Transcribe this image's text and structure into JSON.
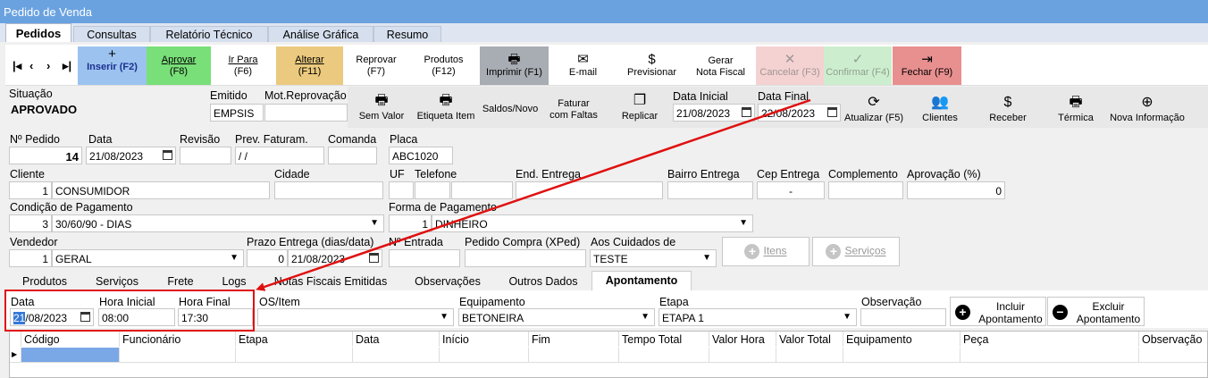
{
  "window": {
    "title": "Pedido de Venda"
  },
  "main_tabs": [
    {
      "label": "Pedidos"
    },
    {
      "label": "Consultas"
    },
    {
      "label": "Relatório Técnico"
    },
    {
      "label": "Análise Gráfica"
    },
    {
      "label": "Resumo"
    }
  ],
  "nav": {
    "first": "⏮",
    "prev": "‹",
    "next": "›",
    "last": "⏭"
  },
  "toolbar": {
    "inserir": "Inserir (F2)",
    "aprovar": "Aprovar",
    "aprovar_key": "(F8)",
    "irpara": "Ir Para",
    "irpara_key": "(F6)",
    "alterar": "Alterar",
    "alterar_key": "(F11)",
    "reprovar": "Reprovar",
    "reprovar_key": "(F7)",
    "produtos": "Produtos",
    "produtos_key": "(F12)",
    "imprimir": "Imprimir (F1)",
    "email": "E-mail",
    "previsionar": "Previsionar",
    "gerar": "Gerar",
    "gerar2": "Nota Fiscal",
    "cancelar": "Cancelar (F3)",
    "confirmar": "Confirmar (F4)",
    "fechar": "Fechar (F9)"
  },
  "status": {
    "situacao_label": "Situação",
    "situacao": "APROVADO",
    "emitido_label": "Emitido",
    "emitido": "EMPSIS",
    "motrep_label": "Mot.Reprovação",
    "motrep": ""
  },
  "actions": {
    "semvalor": "Sem Valor",
    "etiqueta": "Etiqueta Item",
    "saldos": "Saldos/Novo",
    "faturar": "Faturar",
    "faturar2": "com Faltas",
    "replicar": "Replicar",
    "data_inicial_label": "Data Inicial",
    "data_inicial": "21/08/2023",
    "data_final_label": "Data Final",
    "data_final": "22/08/2023",
    "atualizar": "Atualizar (F5)",
    "clientes": "Clientes",
    "receber": "Receber",
    "termica": "Térmica",
    "nova_info": "Nova Informação"
  },
  "form": {
    "pedido_label": "Nº Pedido",
    "pedido": "14",
    "data_label": "Data",
    "data": "21/08/2023",
    "revisao_label": "Revisão",
    "revisao": "",
    "prev_label": "Prev. Faturam.",
    "prev": " /  /",
    "comanda_label": "Comanda",
    "comanda": "",
    "placa_label": "Placa",
    "placa": "ABC1020",
    "cliente_label": "Cliente",
    "cliente_cod": "1",
    "cliente": "CONSUMIDOR",
    "cidade_label": "Cidade",
    "cidade": "",
    "uf_label": "UF",
    "uf": "",
    "telefone_label": "Telefone",
    "telefone": "",
    "end_label": "End. Entrega",
    "end": "",
    "bairro_label": "Bairro Entrega",
    "bairro": "",
    "cep_label": "Cep Entrega",
    "cep": "-",
    "compl_label": "Complemento",
    "compl": "",
    "aprov_label": "Aprovação (%)",
    "aprov": "0",
    "condpag_label": "Condição de Pagamento",
    "condpag_cod": "3",
    "condpag": "30/60/90 - DIAS",
    "formapag_label": "Forma de Pagamento",
    "formapag_cod": "1",
    "formapag": "DINHEIRO",
    "vendedor_label": "Vendedor",
    "vendedor_cod": "1",
    "vendedor": "GERAL",
    "prazo_label": "Prazo Entrega (dias/data)",
    "prazo_dias": "0",
    "prazo_data": "21/08/2023",
    "nf_label": "Nº Entrada",
    "nf": "",
    "pedcompra_label": "Pedido Compra (XPed)",
    "pedcompra": "",
    "cuidados_label": "Aos Cuidados de",
    "cuidados": "TESTE",
    "itens": "Itens",
    "servicos": "Serviços"
  },
  "sub_tabs": [
    {
      "label": "Produtos"
    },
    {
      "label": "Serviços"
    },
    {
      "label": "Frete"
    },
    {
      "label": "Logs"
    },
    {
      "label": "Notas Fiscais Emitidas"
    },
    {
      "label": "Observações"
    },
    {
      "label": "Outros Dados"
    },
    {
      "label": "Apontamento"
    }
  ],
  "apontamento": {
    "data_label": "Data",
    "data_day": "21",
    "data_rest": "/08/2023",
    "hini_label": "Hora Inicial",
    "hini": "08:00",
    "hfim_label": "Hora Final",
    "hfim": "17:30",
    "os_label": "OS/Item",
    "os": "",
    "equip_label": "Equipamento",
    "equip": "BETONEIRA",
    "etapa_label": "Etapa",
    "etapa": "ETAPA 1",
    "obs_label": "Observação",
    "obs": "",
    "incluir": "Incluir",
    "incluir2": "Apontamento",
    "excluir": "Excluir",
    "excluir2": "Apontamento"
  },
  "grid": {
    "columns": [
      "Código",
      "Funcionário",
      "Etapa",
      "Data",
      "Início",
      "Fim",
      "Tempo Total",
      "Valor Hora",
      "Valor Total",
      "Equipamento",
      "Peça",
      "Observação"
    ]
  },
  "colors": {
    "annotation": "#e01010",
    "titlebar": "#6aa2e0"
  }
}
